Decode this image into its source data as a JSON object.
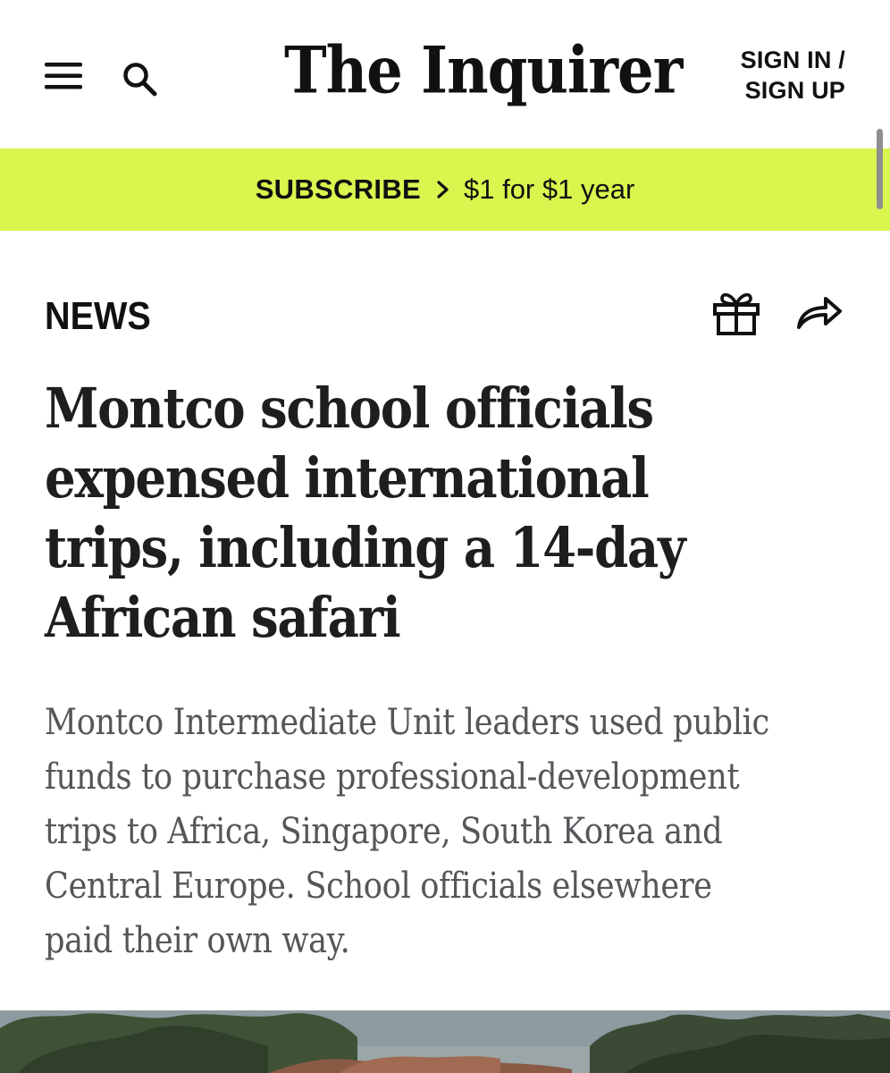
{
  "header": {
    "logo": "The Inquirer",
    "signin_line1": "SIGN IN /",
    "signin_line2": "SIGN UP"
  },
  "promo": {
    "subscribe_label": "SUBSCRIBE",
    "offer": "$1 for $1 year",
    "background_color": "#d8f64e"
  },
  "article": {
    "section": "NEWS",
    "headline": "Montco school officials expensed international trips, including a 14-day African safari",
    "dek": "Montco Intermediate Unit leaders used public funds to purchase professional-development trips to Africa, Singapore, South Korea and Central Europe. School officials elsewhere paid their own way."
  },
  "icons": {
    "menu": "hamburger-icon",
    "search": "search-icon",
    "gift": "gift-icon",
    "share": "share-icon",
    "promo_arrow": "chevron-right-icon"
  }
}
